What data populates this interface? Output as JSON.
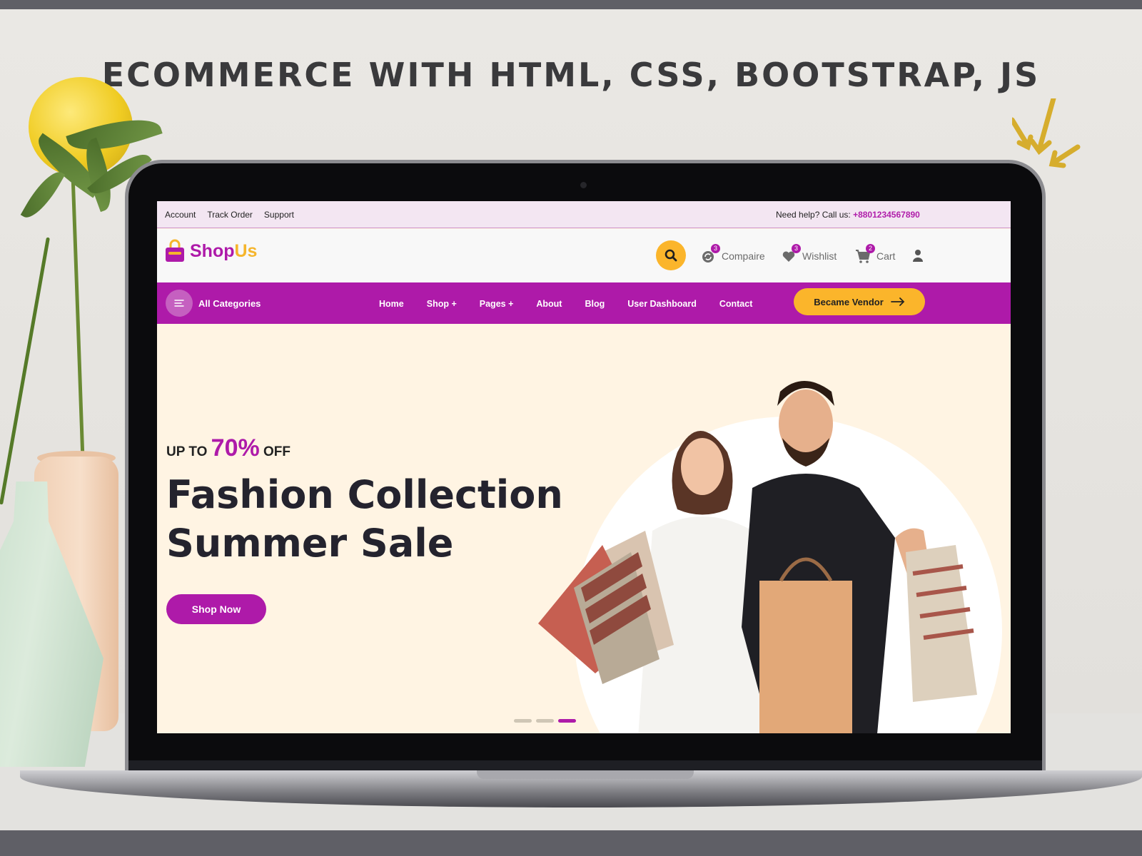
{
  "headline": "ECOMMERCE WITH HTML, CSS, BOOTSTRAP, JS",
  "colors": {
    "brand_purple": "#ae1aa9",
    "accent_yellow": "#fbb52b",
    "hero_bg": "#fff4e3",
    "topbar_bg": "#f3e6f2"
  },
  "topbar": {
    "links": [
      "Account",
      "Track Order",
      "Support"
    ],
    "help_text": "Need help? Call us:",
    "phone": "+8801234567890"
  },
  "header": {
    "logo": {
      "part1": "Shop",
      "part2": "Us",
      "icon": "shopping-bag-icon"
    },
    "search_icon": "search-icon",
    "actions": [
      {
        "label": "Compaire",
        "count": "3",
        "icon": "refresh-icon"
      },
      {
        "label": "Wishlist",
        "count": "3",
        "icon": "heart-icon"
      },
      {
        "label": "Cart",
        "count": "2",
        "icon": "cart-icon"
      }
    ],
    "user_icon": "user-icon"
  },
  "navbar": {
    "categories_label": "All Categories",
    "links": [
      "Home",
      "Shop +",
      "Pages +",
      "About",
      "Blog",
      "User Dashboard",
      "Contact"
    ],
    "vendor_button": "Became Vendor"
  },
  "hero": {
    "promo_prefix": "UP TO",
    "promo_percent": "70%",
    "promo_suffix": "OFF",
    "title_line1": "Fashion Collection",
    "title_line2": "Summer Sale",
    "cta": "Shop Now",
    "slides": 3,
    "active_slide": 3
  }
}
